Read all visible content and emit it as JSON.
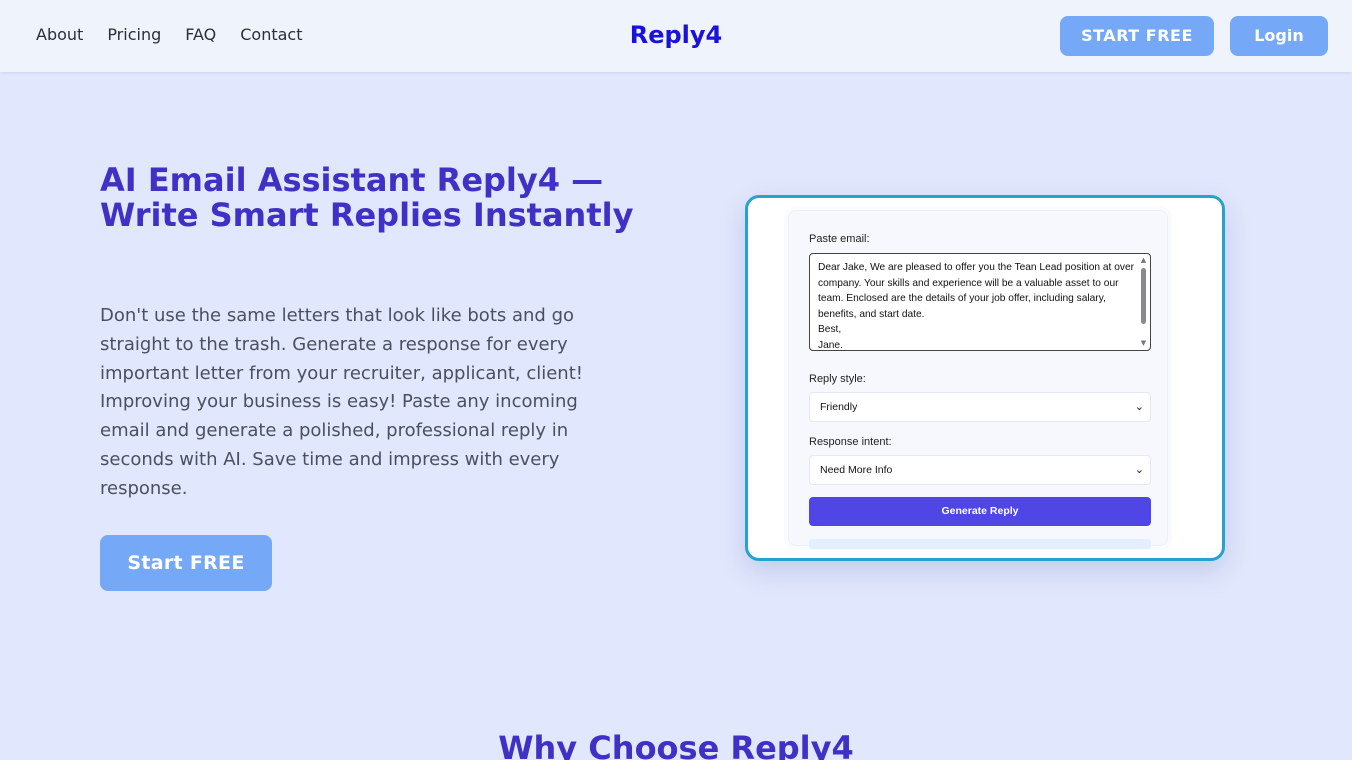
{
  "nav": {
    "links": [
      "About",
      "Pricing",
      "FAQ",
      "Contact"
    ],
    "brand": "Reply4",
    "start_free": "START FREE",
    "login": "Login"
  },
  "hero": {
    "title": "AI Email Assistant Reply4 — Write Smart Replies Instantly",
    "description": "Don't use the same letters that look like bots and go straight to the trash. Generate a response for every important letter from your recruiter, applicant, client! Improving your business is easy! Paste any incoming email and generate a polished, professional reply in seconds with AI. Save time and impress with every response.",
    "cta": "Start FREE"
  },
  "demo": {
    "paste_label": "Paste email:",
    "email_text": "Dear Jake, We are pleased to offer you the Tean Lead position at over company. Your skills and experience will be a valuable asset to our team. Enclosed are the details of your job offer, including salary, benefits, and start date.\nBest,\nJane.",
    "reply_style_label": "Reply style:",
    "reply_style_value": "Friendly",
    "intent_label": "Response intent:",
    "intent_value": "Need More Info",
    "generate_label": "Generate Reply"
  },
  "why": {
    "title": "Why Choose Reply4"
  },
  "colors": {
    "accent": "#4030c5",
    "brand": "#1a12d6",
    "button": "#76a8f8",
    "generate": "#4f46e5",
    "frame": "#27a3c9",
    "background": "#e1e7fc"
  }
}
